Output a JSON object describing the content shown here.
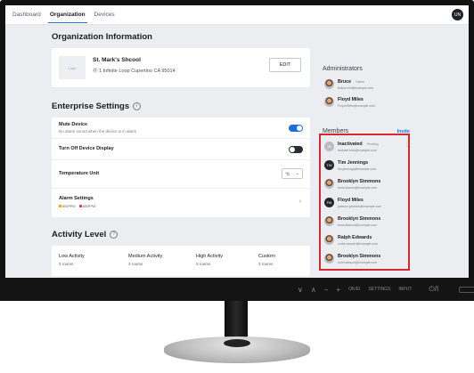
{
  "nav": {
    "tabs": [
      {
        "label": "Dashboard"
      },
      {
        "label": "Organization"
      },
      {
        "label": "Devices"
      }
    ],
    "user_initials": "UN"
  },
  "org": {
    "section_title": "Organization Information",
    "logo_label": "Logo",
    "school_name": "St. Mark's Shcool",
    "address": "Ⓞ 1 Infinite Loop Cupertino CA 95014",
    "edit_label": "EDIT"
  },
  "settings": {
    "title": "Enterprise Settings",
    "mute_label": "Mute Device",
    "mute_sub": "No alarm sound when the device is in alarm",
    "mute_on": true,
    "display_label": "Turn Off Device Display",
    "display_on": false,
    "temp_label": "Temperature Unit",
    "temp_value": "°C",
    "alarm_label": "Alarm Settings",
    "alarm_chip_1": "800PPM",
    "alarm_chip_2": "800PPM"
  },
  "activity": {
    "title": "Activity Level",
    "columns": [
      {
        "label": "Low Activity",
        "value": "3 rooms"
      },
      {
        "label": "Medium Activity",
        "value": "3 rooms"
      },
      {
        "label": "High Activity",
        "value": "3 rooms"
      },
      {
        "label": "Custom",
        "value": "3 rooms"
      }
    ]
  },
  "admins": {
    "title": "Administrators",
    "people": [
      {
        "name": "Bruce",
        "badge": "Owner",
        "email": "felicia.reid@example.com"
      },
      {
        "name": "Floyd Miles",
        "email": "Floyd.Miles@example.com"
      }
    ]
  },
  "members": {
    "title": "Members",
    "invite_label": "Invite",
    "people": [
      {
        "name": "Inactivated",
        "badge": "Pending",
        "email": "michael.mitc@example.com",
        "initials": "IN"
      },
      {
        "name": "Tim Jennings",
        "email": "tim.jennings@example.com",
        "initials": "TW"
      },
      {
        "name": "Brooklyn Simmons",
        "email": "bond.lawson@example.com"
      },
      {
        "name": "Floyd Miles",
        "email": "jackson.graham@example.com",
        "initials": "FM"
      },
      {
        "name": "Brooklyn Simmons",
        "email": "bond.lawson@example.com"
      },
      {
        "name": "Ralph Edwards",
        "email": "curtis.weaver@example.com"
      },
      {
        "name": "Brooklyn Simmons",
        "email": "bond.lawson@example.com"
      }
    ]
  },
  "monitor": {
    "osd_1": "∨",
    "osd_2": "∧",
    "osd_3": "−",
    "osd_4": "+",
    "osd_5": "OK/EI",
    "osd_6": "SETTINGS",
    "osd_7": "INPUT",
    "osd_8": "⏻/I"
  },
  "colors": {
    "accent": "#1d6fe0",
    "highlight": "#d8282f",
    "toggle_on": "#1d6fe0",
    "toggle_off": "#2a2c33"
  }
}
